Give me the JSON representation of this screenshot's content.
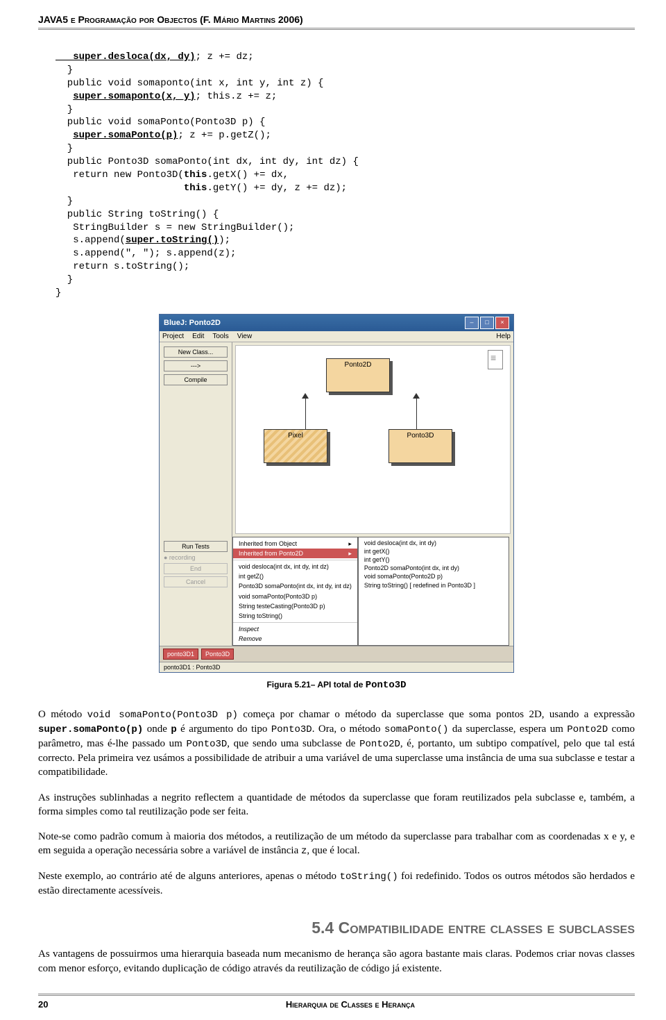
{
  "header": "JAVA5 e Programação por Objectos (F. Mário Martins 2006)",
  "code": {
    "l1a": "   super.desloca(dx, dy)",
    "l1b": "; z += dz;",
    "l2": "  }",
    "l3": "  public void somaponto(int x, int y, int z) {",
    "l4a": "   ",
    "l4b": "super.somaponto(x, y)",
    "l4c": "; this.z += z;",
    "l5": "  }",
    "l6": "  public void somaPonto(Ponto3D p) {",
    "l7a": "   ",
    "l7b": "super.somaPonto(p)",
    "l7c": "; z += p.getZ();",
    "l8": "  }",
    "l9": "  public Ponto3D somaPonto(int dx, int dy, int dz) {",
    "l10a": "   return new Ponto3D(",
    "l10b": "this",
    "l10c": ".getX() += dx,",
    "l11a": "                      ",
    "l11b": "this",
    "l11c": ".getY() += dy, z += dz);",
    "l12": "  }",
    "l13": "  public String toString() {",
    "l14": "   StringBuilder s = new StringBuilder();",
    "l15a": "   s.append(",
    "l15b": "super.toString()",
    "l15c": ");",
    "l16": "   s.append(\", \"); s.append(z);",
    "l17": "   return s.toString();",
    "l18": "  }",
    "l19": "}"
  },
  "bluej": {
    "title": "BlueJ:  Ponto2D",
    "menus": [
      "Project",
      "Edit",
      "Tools",
      "View"
    ],
    "help": "Help",
    "left_buttons": {
      "new_class": "New Class...",
      "arrow": "--->",
      "compile": "Compile"
    },
    "lower_left": {
      "run": "Run Tests",
      "rec": "● recording",
      "end": "End",
      "cancel": "Cancel"
    },
    "classes": {
      "ponto2d": "Ponto2D",
      "pixel": "Pixel",
      "ponto3d": "Ponto3D"
    },
    "ctx_menu": {
      "inherit_obj": "Inherited from Object",
      "inherit_p2d": "Inherited from Ponto2D",
      "m1": "void desloca(int dx, int dy, int dz)",
      "m2": "int getZ()",
      "m3": "Ponto3D somaPonto(int dx, int dy, int dz)",
      "m4": "void somaPonto(Ponto3D p)",
      "m5": "String testeCasting(Ponto3D p)",
      "m6": "String toString()",
      "inspect": "Inspect",
      "remove": "Remove"
    },
    "submenu": {
      "s1": "void desloca(int dx, int dy)",
      "s2": "int getX()",
      "s3": "int getY()",
      "s4": "Ponto2D somaPonto(int dx, int dy)",
      "s5": "void somaPonto(Ponto2D p)",
      "s6": "String toString()   [ redefined in Ponto3D ]"
    },
    "objects": {
      "o1": "ponto3D1",
      "o2": "Ponto3D"
    },
    "status": "ponto3D1 : Ponto3D"
  },
  "caption": {
    "pre": "Figura 5.21– API total de ",
    "mono": "Ponto3D"
  },
  "para1": {
    "t1": "O método ",
    "c1": "void somaPonto(Ponto3D p)",
    "t2": " começa por chamar o método da superclasse que soma pontos 2D, usando a expressão ",
    "c2": "super.somaPonto(p)",
    "t3": " onde ",
    "c3": "p",
    "t4": " é argumento do tipo ",
    "c4": "Ponto3D",
    "t5": ". Ora, o método ",
    "c5": "somaPonto()",
    "t6": " da superclasse, espera um ",
    "c6": "Ponto2D",
    "t7": " como parâmetro, mas é-lhe passado um ",
    "c7": "Ponto3D",
    "t8": ", que sendo uma subclasse de ",
    "c8": "Ponto2D",
    "t9": ", é, portanto, um subtipo compatível, pelo que tal está correcto. Pela primeira vez usámos a possibilidade de atribuir a uma variável de uma superclasse uma instância de uma sua subclasse e testar a compatibilidade."
  },
  "para2": "As instruções sublinhadas a negrito reflectem a quantidade de métodos da superclasse que foram reutilizados pela subclasse e, também, a forma simples como tal reutilização pode ser feita.",
  "para3": {
    "t1": "Note-se como padrão comum à maioria dos métodos, a reutilização de um método da superclasse para trabalhar com as coordenadas x e y, e em seguida a operação necessária sobre a variável de instância ",
    "c1": "z",
    "t2": ", que é local."
  },
  "para4": {
    "t1": "Neste exemplo, ao contrário até de alguns anteriores, apenas o método ",
    "c1": "toString()",
    "t2": " foi redefinido. Todos os outros métodos são herdados e estão directamente acessíveis."
  },
  "section": "5.4  Compatibilidade entre classes e subclasses",
  "para5": "As vantagens de possuirmos uma hierarquia baseada num mecanismo de herança são agora bastante mais claras. Podemos criar novas classes com menor esforço, evitando duplicação de código através da reutilização de código já existente.",
  "footer": {
    "page": "20",
    "chapter": "Hierarquia de Classes e Herança"
  }
}
